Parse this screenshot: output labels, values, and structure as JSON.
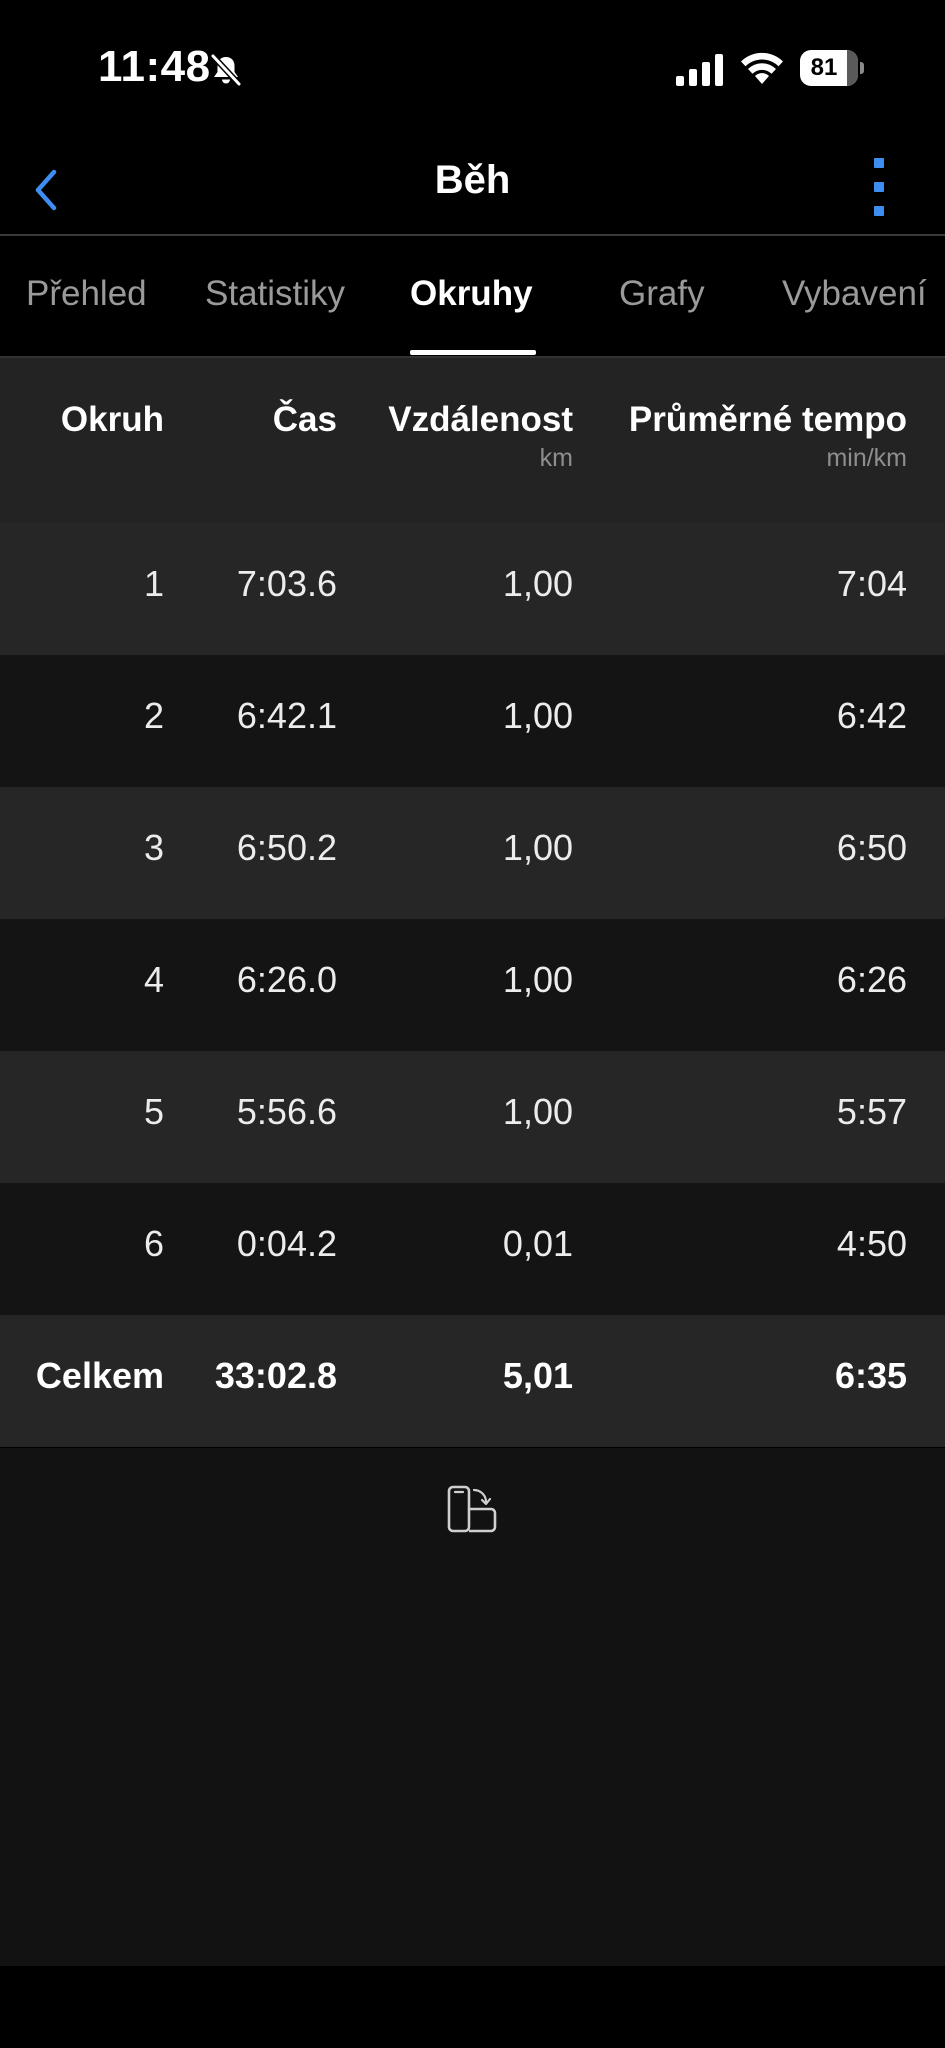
{
  "status_bar": {
    "time": "11:48",
    "battery": "81",
    "battery_level": 0.81,
    "icons": [
      "bell-slash-icon",
      "cellular-signal-icon",
      "wifi-icon",
      "battery-icon"
    ]
  },
  "nav": {
    "title": "Běh",
    "accent_color": "#3d8ef0",
    "icons": [
      "chevron-left-icon",
      "more-vertical-icon"
    ]
  },
  "tabs": [
    {
      "label": "Přehled",
      "active": false
    },
    {
      "label": "Statistiky",
      "active": false
    },
    {
      "label": "Okruhy",
      "active": true
    },
    {
      "label": "Grafy",
      "active": false
    },
    {
      "label": "Vybavení",
      "active": false
    }
  ],
  "table": {
    "columns": [
      {
        "label": "Okruh",
        "unit": ""
      },
      {
        "label": "Čas",
        "unit": ""
      },
      {
        "label": "Vzdálenost",
        "unit": "km"
      },
      {
        "label": "Průměrné tempo",
        "unit": "min/km"
      }
    ],
    "rows": [
      [
        "1",
        "7:03.6",
        "1,00",
        "7:04"
      ],
      [
        "2",
        "6:42.1",
        "1,00",
        "6:42"
      ],
      [
        "3",
        "6:50.2",
        "1,00",
        "6:50"
      ],
      [
        "4",
        "6:26.0",
        "1,00",
        "6:26"
      ],
      [
        "5",
        "5:56.6",
        "1,00",
        "5:57"
      ],
      [
        "6",
        "0:04.2",
        "0,01",
        "4:50"
      ]
    ],
    "total": [
      "Celkem",
      "33:02.8",
      "5,01",
      "6:35"
    ]
  },
  "footer": {
    "icon": "rotate-device-icon"
  }
}
